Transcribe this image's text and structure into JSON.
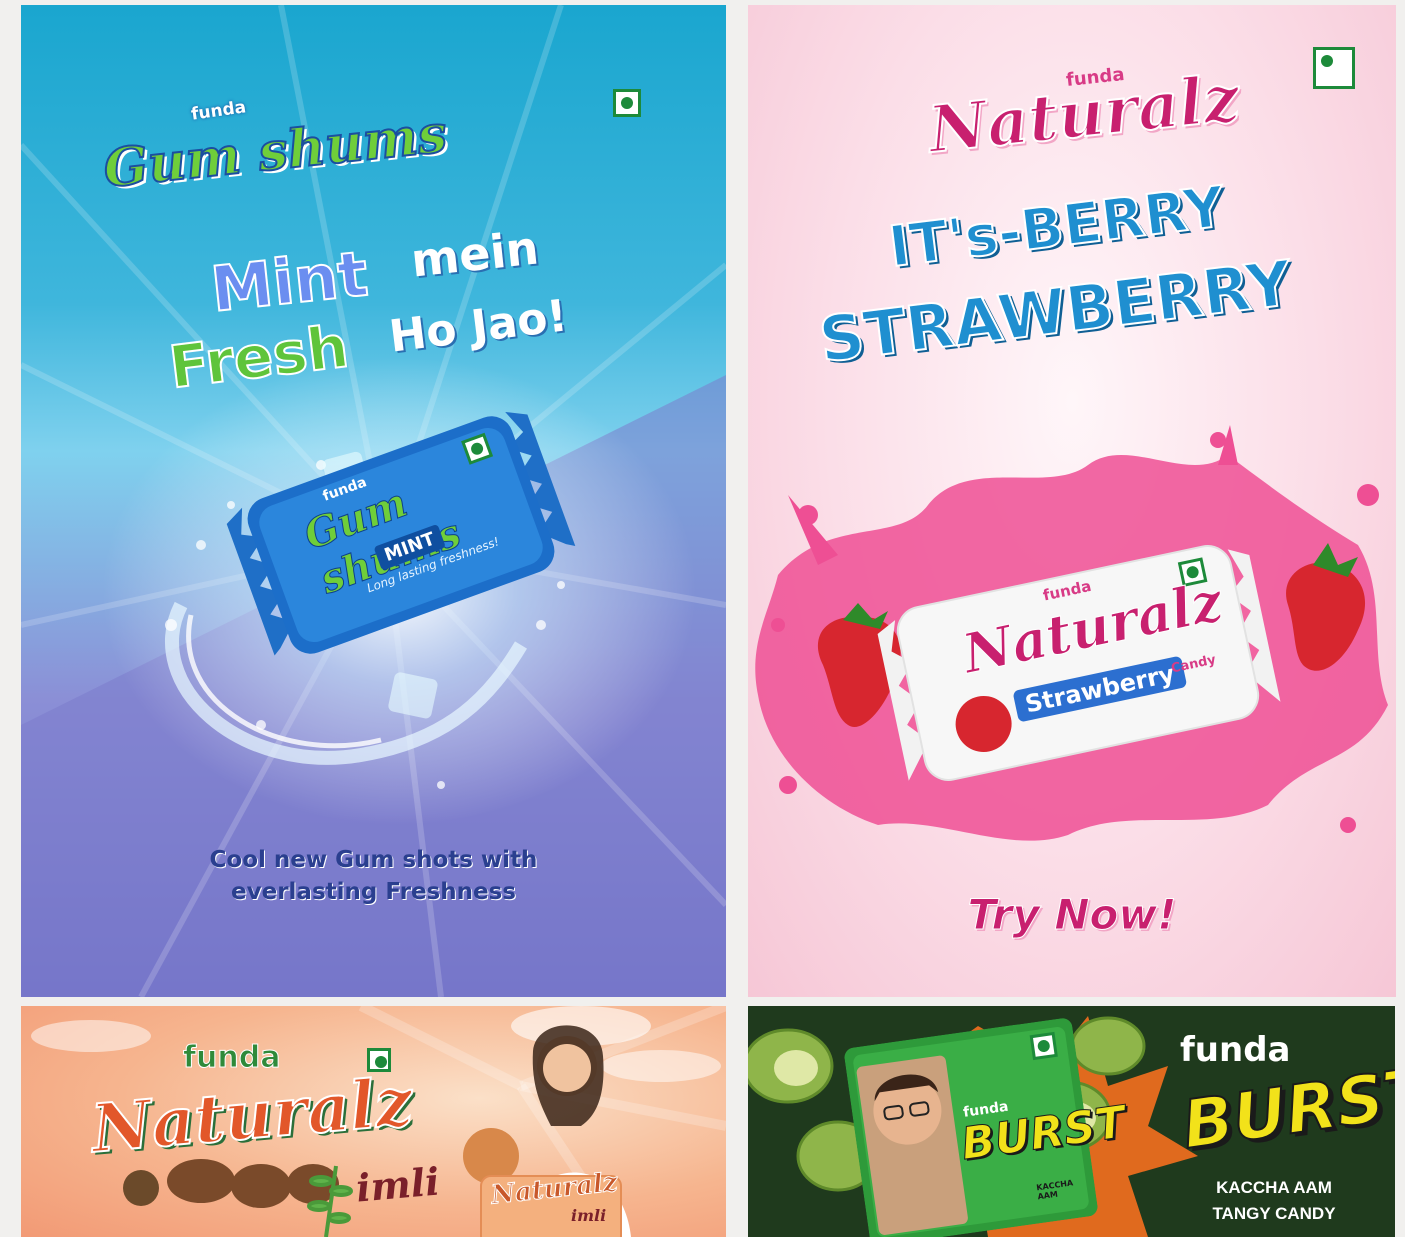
{
  "cards": {
    "gum": {
      "brand_small": "funda",
      "brand": "Gum shums",
      "headline_word1": "Mint",
      "headline_word2": "mein",
      "headline_word3": "Fresh",
      "headline_word4": "Ho Jao!",
      "pack_brand_small": "funda",
      "pack_brand": "Gum shums",
      "pack_flavor": "MINT",
      "pack_tagline": "Long lasting freshness!",
      "tagline_line1": "Cool new Gum shots with",
      "tagline_line2": "everlasting Freshness"
    },
    "strawberry": {
      "brand_small": "funda",
      "brand": "Naturalz",
      "headline_line1": "IT's-BERRY",
      "headline_line2": "STRAWBERRY",
      "pack_brand_small": "funda",
      "pack_brand": "Naturalz",
      "pack_flavor": "Strawberry",
      "pack_type": "Candy",
      "cta": "Try Now!"
    },
    "imli": {
      "brand_small": "funda",
      "brand": "Naturalz",
      "flavor": "imli",
      "pack_brand": "Naturalz",
      "pack_flavor": "imli"
    },
    "burst": {
      "brand_small": "funda",
      "brand": "BURST",
      "pack_brand_small": "funda",
      "pack_brand": "BURST",
      "pack_flavor": "KACCHA AAM",
      "descriptor_line1": "KACCHA AAM",
      "descriptor_line2": "TANGY CANDY"
    }
  },
  "colors": {
    "gum_top": "#1aa6cf",
    "gum_bottom": "#6f6fc6",
    "straw_bg": "#fbdde7",
    "straw_pink": "#e2378a",
    "straw_blue": "#1f8fd0",
    "imli_bg": "#f6b58f",
    "burst_bg": "#1f3a1d",
    "burst_yellow": "#f2e21a",
    "veg_green": "#1d8a3a"
  }
}
